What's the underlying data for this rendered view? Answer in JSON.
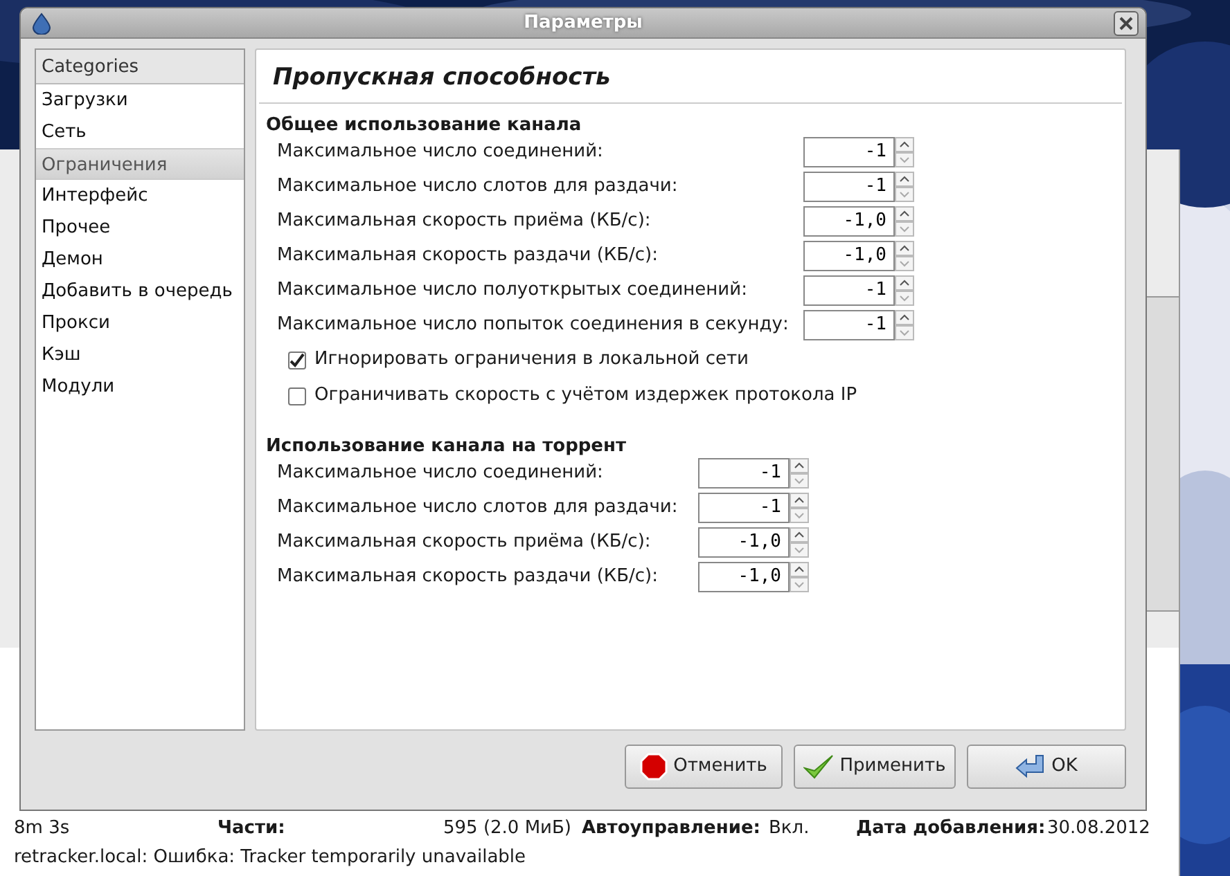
{
  "window": {
    "title": "Параметры"
  },
  "sidebar": {
    "header": "Categories",
    "items": [
      {
        "label": "Загрузки",
        "selected": false
      },
      {
        "label": "Сеть",
        "selected": false
      },
      {
        "label": "Ограничения",
        "selected": true
      },
      {
        "label": "Интерфейс",
        "selected": false
      },
      {
        "label": "Прочее",
        "selected": false
      },
      {
        "label": "Демон",
        "selected": false
      },
      {
        "label": "Добавить в очередь",
        "selected": false
      },
      {
        "label": "Прокси",
        "selected": false
      },
      {
        "label": "Кэш",
        "selected": false
      },
      {
        "label": "Модули",
        "selected": false
      }
    ]
  },
  "page": {
    "title": "Пропускная способность",
    "sections": [
      {
        "title": "Общее использование канала",
        "fields": [
          {
            "label": "Максимальное число соединений:",
            "value": "-1"
          },
          {
            "label": "Максимальное число слотов для раздачи:",
            "value": "-1"
          },
          {
            "label": "Максимальная скорость приёма (КБ/с):",
            "value": "-1,0"
          },
          {
            "label": "Максимальная скорость раздачи (КБ/с):",
            "value": "-1,0"
          },
          {
            "label": "Максимальное число полуоткрытых соединений:",
            "value": "-1"
          },
          {
            "label": "Максимальное число попыток соединения в секунду:",
            "value": "-1"
          }
        ],
        "checkboxes": [
          {
            "label": "Игнорировать ограничения в локальной сети",
            "checked": true
          },
          {
            "label": "Ограничивать скорость с учётом издержек протокола IP",
            "checked": false
          }
        ]
      },
      {
        "title": "Использование канала на торрент",
        "fields": [
          {
            "label": "Максимальное число соединений:",
            "value": "-1"
          },
          {
            "label": "Максимальное число слотов для раздачи:",
            "value": "-1"
          },
          {
            "label": "Максимальная скорость приёма (КБ/с):",
            "value": "-1,0"
          },
          {
            "label": "Максимальная скорость раздачи (КБ/с):",
            "value": "-1,0"
          }
        ]
      }
    ]
  },
  "buttons": [
    {
      "label": "Отменить",
      "kind": "cancel"
    },
    {
      "label": "Применить",
      "kind": "apply"
    },
    {
      "label": "OK",
      "kind": "ok"
    }
  ],
  "background_window": {
    "status_rows": [
      [
        {
          "text": "8m 3s",
          "kind": "value"
        },
        {
          "text": "Части:",
          "kind": "label"
        },
        {
          "text": "595 (2.0 МиБ)",
          "kind": "value"
        },
        {
          "text": "Автоуправление:",
          "kind": "label"
        },
        {
          "text": "Вкл.",
          "kind": "value"
        },
        {
          "text": "Дата добавления:",
          "kind": "label"
        },
        {
          "text": "30.08.2012",
          "kind": "value"
        }
      ],
      [
        {
          "text": "retracker.local: Ошибка: Tracker temporarily unavailable",
          "kind": "value"
        }
      ]
    ]
  }
}
